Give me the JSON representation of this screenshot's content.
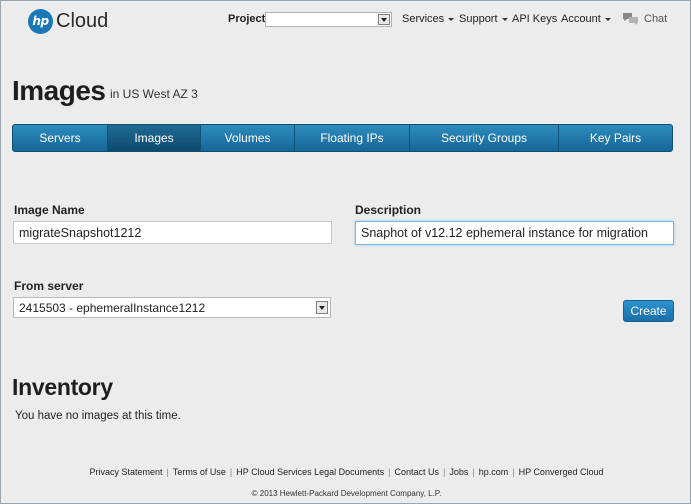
{
  "header": {
    "logo_mark": "hp",
    "logo_text": "Cloud",
    "project_label": "Project:",
    "project_value": "",
    "nav": [
      {
        "label": "Services",
        "caret": true
      },
      {
        "label": "Support",
        "caret": true
      },
      {
        "label": "API Keys",
        "caret": false
      },
      {
        "label": "Account",
        "caret": true
      }
    ],
    "chat_label": "Chat",
    "chat_icon": "chat-bubbles-icon"
  },
  "page": {
    "title": "Images",
    "region": "in US West AZ 3"
  },
  "tabs": [
    {
      "label": "Servers",
      "active": false
    },
    {
      "label": "Images",
      "active": true
    },
    {
      "label": "Volumes",
      "active": false
    },
    {
      "label": "Floating IPs",
      "active": false
    },
    {
      "label": "Security Groups",
      "active": false
    },
    {
      "label": "Key Pairs",
      "active": false
    }
  ],
  "form": {
    "image_name_label": "Image Name",
    "image_name_value": "migrateSnapshot1212",
    "description_label": "Description",
    "description_value": "Snaphot of v12.12 ephemeral instance for migration",
    "from_server_label": "From server",
    "from_server_value": "2415503 - ephemeralInstance1212",
    "create_label": "Create"
  },
  "inventory": {
    "title": "Inventory",
    "empty_message": "You have no images at this time."
  },
  "footer": {
    "links": [
      "Privacy Statement",
      "Terms of Use",
      "HP Cloud Services Legal Documents",
      "Contact Us",
      "Jobs",
      "hp.com",
      "HP Converged Cloud"
    ],
    "copyright": "© 2013 Hewlett-Packard Development Company, L.P."
  },
  "colors": {
    "accent": "#1a78b8",
    "tab_bar": "#2080b4",
    "tab_active": "#15557c",
    "background": "#ececec"
  }
}
